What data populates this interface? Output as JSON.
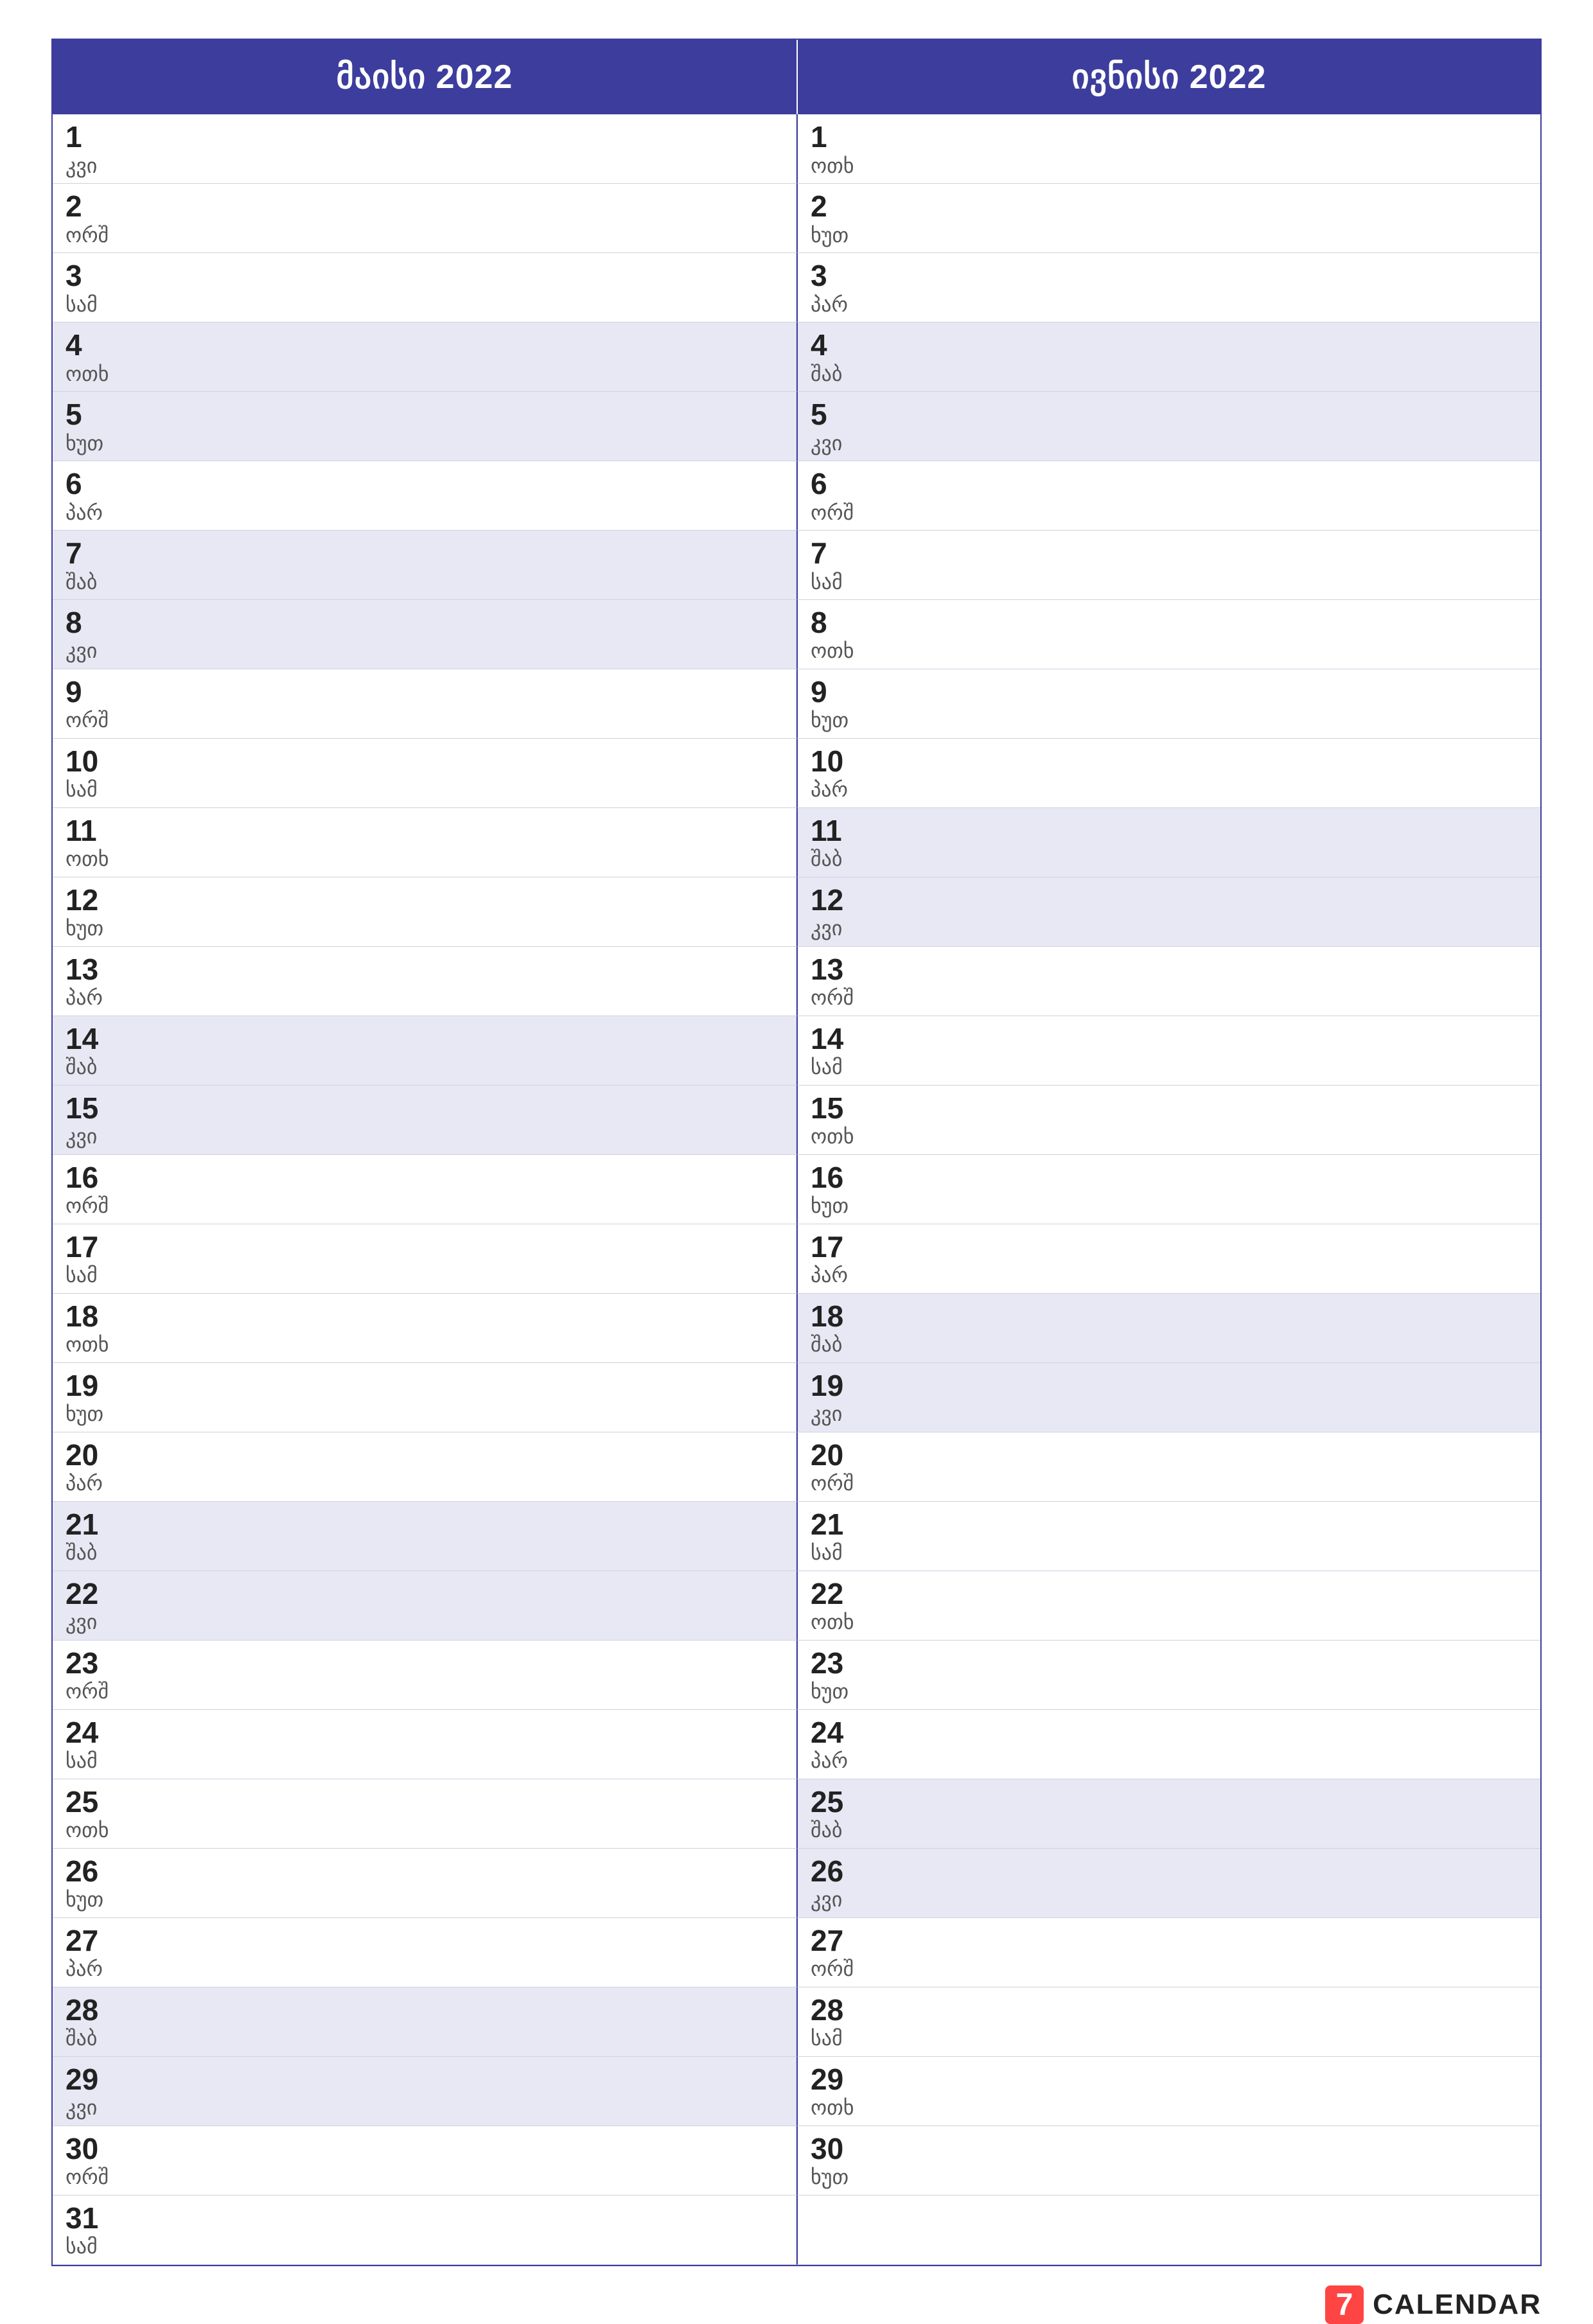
{
  "months": [
    {
      "title": "მაისი 2022",
      "days": [
        {
          "num": "1",
          "name": "კვი",
          "highlight": false
        },
        {
          "num": "2",
          "name": "ორშ",
          "highlight": false
        },
        {
          "num": "3",
          "name": "სამ",
          "highlight": false
        },
        {
          "num": "4",
          "name": "ოთხ",
          "highlight": true
        },
        {
          "num": "5",
          "name": "ხუთ",
          "highlight": true
        },
        {
          "num": "6",
          "name": "პარ",
          "highlight": false
        },
        {
          "num": "7",
          "name": "შაბ",
          "highlight": true
        },
        {
          "num": "8",
          "name": "კვი",
          "highlight": true
        },
        {
          "num": "9",
          "name": "ორშ",
          "highlight": false
        },
        {
          "num": "10",
          "name": "სამ",
          "highlight": false
        },
        {
          "num": "11",
          "name": "ოთხ",
          "highlight": false
        },
        {
          "num": "12",
          "name": "ხუთ",
          "highlight": false
        },
        {
          "num": "13",
          "name": "პარ",
          "highlight": false
        },
        {
          "num": "14",
          "name": "შაბ",
          "highlight": true
        },
        {
          "num": "15",
          "name": "კვი",
          "highlight": true
        },
        {
          "num": "16",
          "name": "ორშ",
          "highlight": false
        },
        {
          "num": "17",
          "name": "სამ",
          "highlight": false
        },
        {
          "num": "18",
          "name": "ოთხ",
          "highlight": false
        },
        {
          "num": "19",
          "name": "ხუთ",
          "highlight": false
        },
        {
          "num": "20",
          "name": "პარ",
          "highlight": false
        },
        {
          "num": "21",
          "name": "შაბ",
          "highlight": true
        },
        {
          "num": "22",
          "name": "კვი",
          "highlight": true
        },
        {
          "num": "23",
          "name": "ორშ",
          "highlight": false
        },
        {
          "num": "24",
          "name": "სამ",
          "highlight": false
        },
        {
          "num": "25",
          "name": "ოთხ",
          "highlight": false
        },
        {
          "num": "26",
          "name": "ხუთ",
          "highlight": false
        },
        {
          "num": "27",
          "name": "პარ",
          "highlight": false
        },
        {
          "num": "28",
          "name": "შაბ",
          "highlight": true
        },
        {
          "num": "29",
          "name": "კვი",
          "highlight": true
        },
        {
          "num": "30",
          "name": "ორშ",
          "highlight": false
        },
        {
          "num": "31",
          "name": "სამ",
          "highlight": false
        }
      ]
    },
    {
      "title": "ივნისი 2022",
      "days": [
        {
          "num": "1",
          "name": "ოთხ",
          "highlight": false
        },
        {
          "num": "2",
          "name": "ხუთ",
          "highlight": false
        },
        {
          "num": "3",
          "name": "პარ",
          "highlight": false
        },
        {
          "num": "4",
          "name": "შაბ",
          "highlight": true
        },
        {
          "num": "5",
          "name": "კვი",
          "highlight": true
        },
        {
          "num": "6",
          "name": "ორშ",
          "highlight": false
        },
        {
          "num": "7",
          "name": "სამ",
          "highlight": false
        },
        {
          "num": "8",
          "name": "ოთხ",
          "highlight": false
        },
        {
          "num": "9",
          "name": "ხუთ",
          "highlight": false
        },
        {
          "num": "10",
          "name": "პარ",
          "highlight": false
        },
        {
          "num": "11",
          "name": "შაბ",
          "highlight": true
        },
        {
          "num": "12",
          "name": "კვი",
          "highlight": true
        },
        {
          "num": "13",
          "name": "ორშ",
          "highlight": false
        },
        {
          "num": "14",
          "name": "სამ",
          "highlight": false
        },
        {
          "num": "15",
          "name": "ოთხ",
          "highlight": false
        },
        {
          "num": "16",
          "name": "ხუთ",
          "highlight": false
        },
        {
          "num": "17",
          "name": "პარ",
          "highlight": false
        },
        {
          "num": "18",
          "name": "შაბ",
          "highlight": true
        },
        {
          "num": "19",
          "name": "კვი",
          "highlight": true
        },
        {
          "num": "20",
          "name": "ორშ",
          "highlight": false
        },
        {
          "num": "21",
          "name": "სამ",
          "highlight": false
        },
        {
          "num": "22",
          "name": "ოთხ",
          "highlight": false
        },
        {
          "num": "23",
          "name": "ხუთ",
          "highlight": false
        },
        {
          "num": "24",
          "name": "პარ",
          "highlight": false
        },
        {
          "num": "25",
          "name": "შაბ",
          "highlight": true
        },
        {
          "num": "26",
          "name": "კვი",
          "highlight": true
        },
        {
          "num": "27",
          "name": "ორშ",
          "highlight": false
        },
        {
          "num": "28",
          "name": "სამ",
          "highlight": false
        },
        {
          "num": "29",
          "name": "ოთხ",
          "highlight": false
        },
        {
          "num": "30",
          "name": "ხუთ",
          "highlight": false
        }
      ]
    }
  ],
  "brand": {
    "text": "CALENDAR"
  }
}
